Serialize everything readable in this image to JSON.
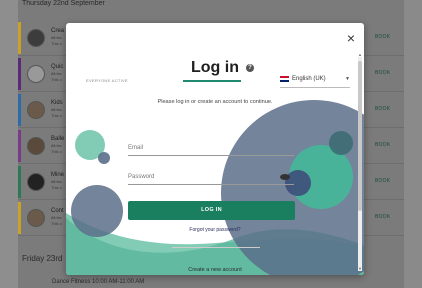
{
  "background": {
    "day1_header": "Thursday 22nd September",
    "day2_header": "Friday 23rd",
    "classes": [
      {
        "name": "Crea",
        "sub": "All lev",
        "sub2": "This c",
        "stripe": "#c9a227",
        "book": "BOOK"
      },
      {
        "name": "Quic",
        "sub": "All lev",
        "sub2": "This c",
        "stripe": "#5a2a7a",
        "book": "BOOK"
      },
      {
        "name": "Kids",
        "sub": "All lev",
        "sub2": "This c",
        "stripe": "#2b6ca6",
        "book": "BOOK"
      },
      {
        "name": "Balle",
        "sub": "All lev",
        "sub2": "This c",
        "stripe": "#7a3a8a",
        "book": "BOOK"
      },
      {
        "name": "Mine",
        "sub": "All lev",
        "sub2": "This c",
        "stripe": "#2a7a5a",
        "book": "BOOK"
      },
      {
        "name": "Cont",
        "sub": "All lev",
        "sub2": "This c",
        "stripe": "#c9a227",
        "book": "BOOK"
      }
    ],
    "friday_class": "Dance Fitness 10:00 AM-11:00 AM"
  },
  "modal": {
    "title": "Log in",
    "logo_text": "EVERYONE ACTIVE",
    "language": "English (UK)",
    "intro": "Please log in or create an account to continue.",
    "email_label": "Email",
    "password_label": "Password",
    "login_button": "LOG IN",
    "forgot_password": "Forgot your password?",
    "create_account": "Create a new account",
    "close_glyph": "×",
    "help_glyph": "?",
    "accent_color": "#1a7f5f"
  }
}
